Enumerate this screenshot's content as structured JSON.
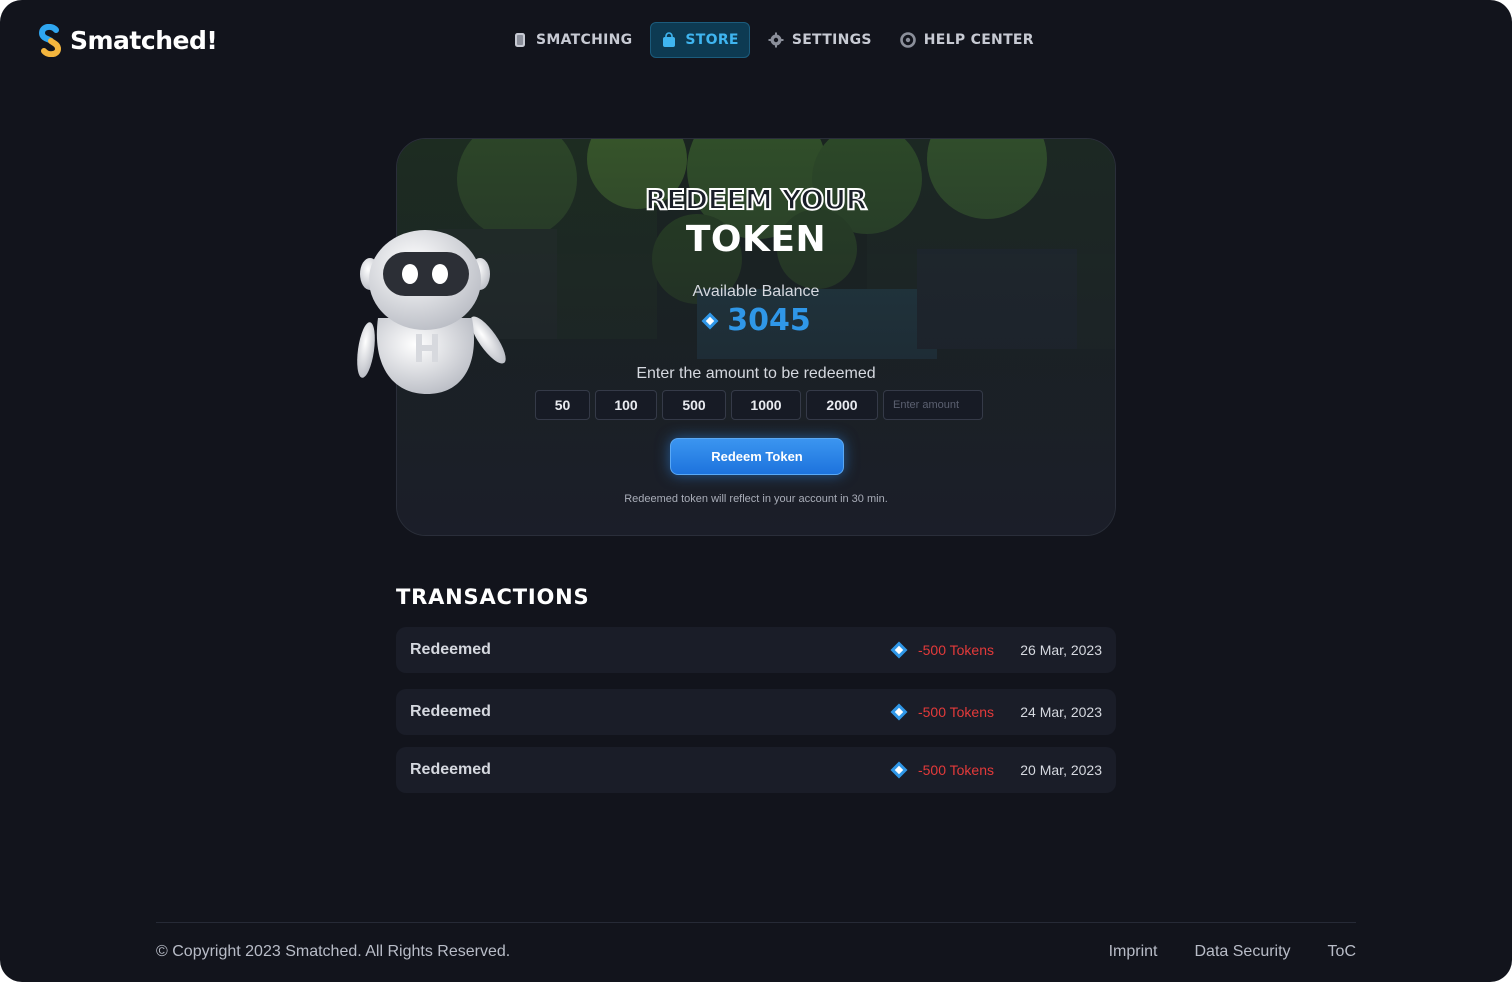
{
  "app": {
    "name": "Smatched!"
  },
  "nav": {
    "items": [
      {
        "label": "SMATCHING",
        "icon": "phone-icon"
      },
      {
        "label": "STORE",
        "icon": "bag-icon",
        "active": true
      },
      {
        "label": "SETTINGS",
        "icon": "gear-icon"
      },
      {
        "label": "HELP CENTER",
        "icon": "lifebuoy-icon"
      }
    ]
  },
  "redeem": {
    "title_line1": "REDEEM YOUR",
    "title_line2": "TOKEN",
    "balance_label": "Available Balance",
    "balance_value": "3045",
    "amount_label": "Enter the amount to be redeemed",
    "amount_options": [
      "50",
      "100",
      "500",
      "1000",
      "2000"
    ],
    "amount_input_placeholder": "Enter amount",
    "button_label": "Redeem Token",
    "note": "Redeemed token will reflect in your account in 30 min."
  },
  "transactions": {
    "title": "TRANSACTIONS",
    "rows": [
      {
        "label": "Redeemed",
        "amount": "-500 Tokens",
        "date": "26 Mar, 2023"
      },
      {
        "label": "Redeemed",
        "amount": "-500 Tokens",
        "date": "24 Mar, 2023"
      },
      {
        "label": "Redeemed",
        "amount": "-500 Tokens",
        "date": "20 Mar, 2023"
      }
    ]
  },
  "footer": {
    "copyright": "© Copyright 2023 Smatched. All Rights Reserved.",
    "links": [
      "Imprint",
      "Data Security",
      "ToC"
    ]
  },
  "colors": {
    "background": "#12141c",
    "accent": "#2f97e8",
    "negative": "#e33a3a",
    "active_nav": "#0d3a52"
  }
}
